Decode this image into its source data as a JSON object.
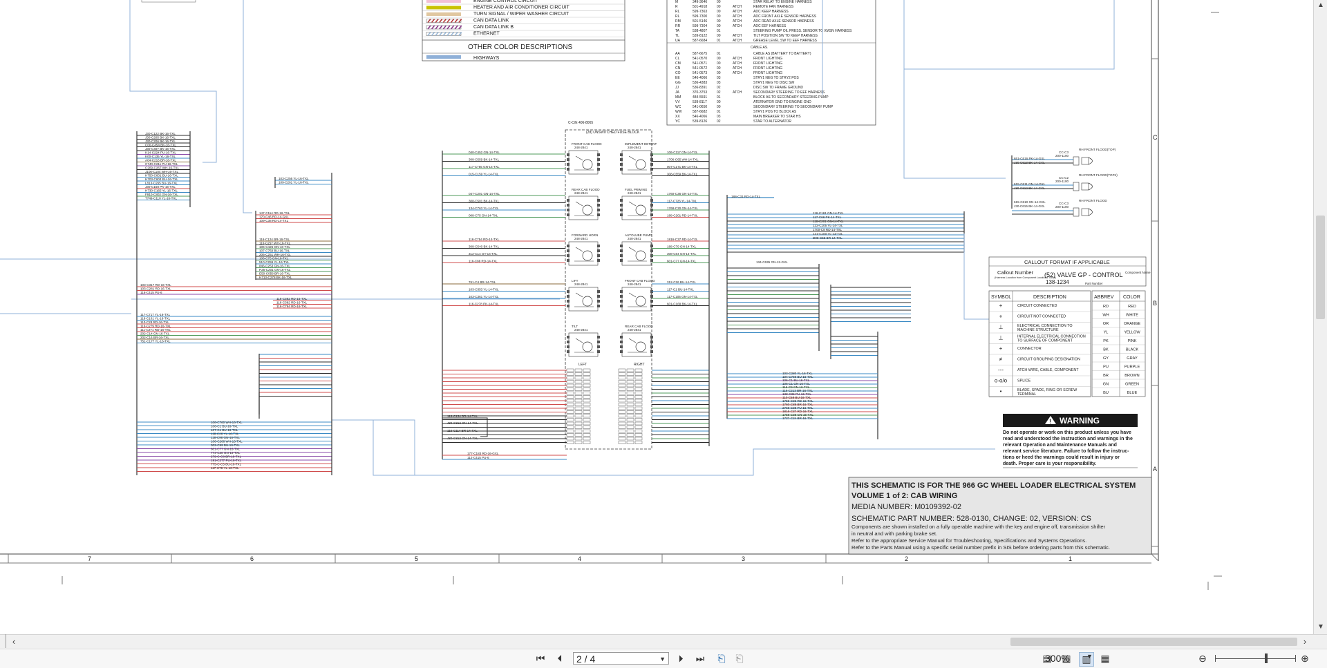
{
  "legend": {
    "rows": [
      {
        "label": "ENGINE CONTROL CIRCUIT",
        "color": "#f2c0d4",
        "style": "solid"
      },
      {
        "label": "HEATER AND AIR CONDITIONER CIRCUIT",
        "color": "#c9c200",
        "style": "solid"
      },
      {
        "label": "TURN SIGNAL / WIPER WASHER CIRCUIT",
        "color": "#e0c7a0",
        "style": "solid"
      },
      {
        "label": "CAN DATA LINK",
        "color": "#b23a3a",
        "style": "hatch"
      },
      {
        "label": "CAN DATA LINK B",
        "color": "#8a3a8a",
        "style": "hatch"
      },
      {
        "label": "ETHERNET",
        "color": "#9ab8d6",
        "style": "hatch"
      }
    ],
    "other_heading": "OTHER COLOR DESCRIPTIONS",
    "other_rows": [
      {
        "label": "HIGHWAYS",
        "color": "#8fb0d8"
      }
    ]
  },
  "parts_table": {
    "rows_top": [
      {
        "code": "M",
        "pn": "349-3646",
        "grp": "00",
        "att": "",
        "desc": "STAR RELAY TO ENGINE HARNESS"
      },
      {
        "code": "R",
        "pn": "501-4918",
        "grp": "00",
        "att": "ATCH",
        "desc": "REMOTE FAN HARNESS"
      },
      {
        "code": "RL",
        "pn": "599-7363",
        "grp": "00",
        "att": "ATCH",
        "desc": "ADC KEEP HARNESS"
      },
      {
        "code": "RL",
        "pn": "599-7300",
        "grp": "00",
        "att": "ATCH",
        "desc": "ADC FRONT AXLE SENSOR HARNESS"
      },
      {
        "code": "RM",
        "pn": "501-5146",
        "grp": "00",
        "att": "ATCH",
        "desc": "ADC REAR AXLE SENSOR HARNESS"
      },
      {
        "code": "RR",
        "pn": "599-7304",
        "grp": "00",
        "att": "ATCH",
        "desc": "ADC EEF HARNESS"
      },
      {
        "code": "TA",
        "pn": "538-4807",
        "grp": "01",
        "att": "",
        "desc": "STEERING PUMP OIL PRESS. SENSOR TO XMSN HARNESS"
      },
      {
        "code": "TL",
        "pn": "539-8122",
        "grp": "00",
        "att": "ATCH",
        "desc": "TILT POSITION SW TO KEEP HARNESS"
      },
      {
        "code": "UA",
        "pn": "587-6684",
        "grp": "01",
        "att": "ATCH",
        "desc": "GREASE LEVEL SW TO EEF HARNESS"
      }
    ],
    "cable_heading": "CABLE AS.",
    "rows_cable": [
      {
        "code": "AA",
        "pn": "587-6675",
        "grp": "01",
        "att": "",
        "desc": "CABLE AS (BATTERY TO BATTERY)"
      },
      {
        "code": "CL",
        "pn": "541-0570",
        "grp": "00",
        "att": "ATCH",
        "desc": "FRONT LIGHTING"
      },
      {
        "code": "CM",
        "pn": "541-0571",
        "grp": "00",
        "att": "ATCH",
        "desc": "FRONT LIGHTING"
      },
      {
        "code": "CN",
        "pn": "541-0572",
        "grp": "00",
        "att": "ATCH",
        "desc": "FRONT LIGHTING"
      },
      {
        "code": "CO",
        "pn": "541-0573",
        "grp": "00",
        "att": "ATCH",
        "desc": "FRONT LIGHTING"
      },
      {
        "code": "EE",
        "pn": "546-4066",
        "grp": "03",
        "att": "",
        "desc": "STRY1 NEG TO STRY2 POS"
      },
      {
        "code": "GG",
        "pn": "536-4383",
        "grp": "03",
        "att": "",
        "desc": "STRY1 NEG TO DISC SW"
      },
      {
        "code": "JJ",
        "pn": "536-8391",
        "grp": "02",
        "att": "",
        "desc": "DISC SW TO FRAME GROUND"
      },
      {
        "code": "JA",
        "pn": "370-3753",
        "grp": "02",
        "att": "ATCH",
        "desc": "SECONDARY STEERING TO EEF HARNESS"
      },
      {
        "code": "MM",
        "pn": "484-5591",
        "grp": "01",
        "att": "",
        "desc": "BLOCK AS TO SECONDARY STEERING PUMP"
      },
      {
        "code": "VV",
        "pn": "539-8117",
        "grp": "00",
        "att": "",
        "desc": "ATERNATOR GND TO ENGINE GND"
      },
      {
        "code": "WC",
        "pn": "541-0650",
        "grp": "00",
        "att": "",
        "desc": "SECONDARY STEERING TO SECONDARY PUMP"
      },
      {
        "code": "WW",
        "pn": "587-6682",
        "grp": "01",
        "att": "",
        "desc": "STRY1 POS TO BLOCK AS"
      },
      {
        "code": "XX",
        "pn": "546-4066",
        "grp": "03",
        "att": "",
        "desc": "MAIN BREAKER TO STAR HS"
      },
      {
        "code": "YC",
        "pn": "539-8126",
        "grp": "02",
        "att": "",
        "desc": "STAR TO ALTERNATOR"
      }
    ]
  },
  "fuse_block": {
    "header": "C-C/E 406-8065",
    "title": "(28) UNSWITCHED FUSE BLOCK",
    "relays_left": [
      {
        "name": "FRONT CAB FLOOD",
        "pn": "248-2841"
      },
      {
        "name": "REAR CAB FLOOD",
        "pn": "248-2841"
      },
      {
        "name": "FORWARD HORN",
        "pn": "248-2841"
      },
      {
        "name": "LIFT",
        "pn": "248-2841"
      },
      {
        "name": "TILT",
        "pn": "248-2841"
      }
    ],
    "relays_right": [
      {
        "name": "IMPLEMENT DETENT",
        "pn": "248-2841"
      },
      {
        "name": "FUEL PRIMING",
        "pn": "248-2841"
      },
      {
        "name": "AUTOLUBE PUMP",
        "pn": "248-2841"
      },
      {
        "name": "FRONT CAB FLOOD",
        "pn": "248-2841"
      },
      {
        "name": "REAR CAB FLOOD",
        "pn": "248-2841"
      }
    ],
    "left_label": "LEFT",
    "right_label": "RIGHT"
  },
  "lamps": [
    {
      "id": "CC-C3",
      "pn": "200-1100",
      "name": "RH FRONT FLOOD(TOP)"
    },
    {
      "id": "CC-C2",
      "pn": "200-1100",
      "name": "RH FRONT FLOOD(TOP4)"
    },
    {
      "id": "CC-C3",
      "pn": "200-1100",
      "name": "RH FRONT FLOOD"
    }
  ],
  "callout": {
    "title": "CALLOUT FORMAT IF APPLICABLE",
    "label": "Callout Number",
    "note": "(Harness Location from Component Locations Table)",
    "example": "(52) VALVE GP - CONTROL",
    "example2": "138-1234",
    "component": "Component Name",
    "part": "Part Number"
  },
  "symbols": {
    "h_symbol": "SYMBOL",
    "h_desc": "DESCRIPTION",
    "rows": [
      {
        "sym": "+",
        "desc": "CIRCUIT CONNECTED"
      },
      {
        "sym": "+",
        "desc": "CIRCUIT NOT CONNECTED"
      },
      {
        "sym": "⊥",
        "desc": "ELECTRICAL CONNECTION TO MACHINE STRUCTURE"
      },
      {
        "sym": "⊥",
        "desc": "INTERNAL ELECTRICAL CONNECTION TO SURFACE OF COMPONENT"
      },
      {
        "sym": "+",
        "desc": "CONNECTOR"
      },
      {
        "sym": "≠",
        "desc": "CIRCUIT GROUPING DESIGNATION"
      },
      {
        "sym": "---",
        "desc": "ATCH WIRE, CABLE, COMPONENT"
      },
      {
        "sym": "o-o/o",
        "desc": "SPLICE"
      },
      {
        "sym": "•",
        "desc": "BLADE, SPADE, RING OR SCREW TERMINAL"
      }
    ]
  },
  "abbrev": {
    "h_abbrev": "ABBREV",
    "h_color": "COLOR",
    "rows": [
      {
        "a": "RD",
        "c": "RED"
      },
      {
        "a": "WH",
        "c": "WHITE"
      },
      {
        "a": "OR",
        "c": "ORANGE"
      },
      {
        "a": "YL",
        "c": "YELLOW"
      },
      {
        "a": "PK",
        "c": "PINK"
      },
      {
        "a": "BK",
        "c": "BLACK"
      },
      {
        "a": "GY",
        "c": "GRAY"
      },
      {
        "a": "PU",
        "c": "PURPLE"
      },
      {
        "a": "BR",
        "c": "BROWN"
      },
      {
        "a": "GN",
        "c": "GREEN"
      },
      {
        "a": "BU",
        "c": "BLUE"
      }
    ]
  },
  "warning": {
    "title": "WARNING",
    "line1": "Do not operate or work on this product unless you have",
    "line2": "read and understood the instruction and warnings in the",
    "line3": "relevant Operation and Maintenance Manuals and",
    "line4": "relevant service literature. Failure to follow the instruc-",
    "line5": "tions or heed the warnings could result in injury or",
    "line6": "death. Proper care is your responsibility."
  },
  "title_block": {
    "line1": "THIS SCHEMATIC IS FOR THE 966 GC WHEEL LOADER ELECTRICAL SYSTEM",
    "line2": "VOLUME 1 of 2: CAB WIRING",
    "line3": "MEDIA NUMBER: M0109392-02",
    "line4": "SCHEMATIC PART NUMBER: 528-0130, CHANGE: 02, VERSION: CS",
    "line5": "Components are shown installed on a fully operable machine with the key and engine off, transmission shifter",
    "line6": "in neutral and with parking brake set.",
    "line7": "Refer to the appropriate Service Manual for Troubleshooting, Specifications and Systems Operations.",
    "line8": "Refer to the Parts Manual using a specific serial number prefix in SIS before ordering parts from this schematic."
  },
  "grid": {
    "columns": [
      "7",
      "6",
      "5",
      "4",
      "3",
      "2",
      "1"
    ],
    "rows": [
      "C",
      "B",
      "A"
    ]
  },
  "viewer": {
    "page_value": "2 / 4",
    "zoom": "300%",
    "icons": [
      "first-page-icon",
      "prev-page-icon",
      "next-page-icon",
      "last-page-icon",
      "copy-view-icon",
      "copy-view-2-icon",
      "single-page-icon",
      "continuous-icon",
      "two-page-icon",
      "two-page-continuous-icon",
      "zoom-out-icon",
      "zoom-in-icon"
    ]
  },
  "wire_labels": {
    "a": [
      "J30-C122 BK-16-TXL",
      "J30-C205 BK-16-TXL",
      "J30-C206 BK-16-TXL",
      "C00-C454 BK-16-TXL",
      "J30-C407 BK-16-TXL",
      "K14-C224 PU-16-TXL",
      "K00-C135 YL-16-TXL",
      "A04-C216 BR-16-TXL",
      "C740-C211 PU-16-TXL",
      "C209-C267 WH-16-TXL",
      "J100-C104 WH-16-TXL",
      "H750-C601 BU-16-TXL",
      "H703-C604 BU-16-TXL",
      "L813-C265 BU-16-TXL",
      "J30-C158 PK-16-TXL",
      "H730-C165 YL-16-TXL",
      "F910-C802 GN-16-TXL",
      "T749-C110 YL-16-TXL"
    ],
    "b": [
      "103-C256 YL-16-TXL",
      "109-C261 YL-16-TXL"
    ],
    "c": [
      "147-C114 RD-16-TXL",
      "170-C46 RD-14-GXL",
      "109-C38 RD-14-TXL"
    ],
    "d": [
      "116-C124 BR-16-TXL",
      "116-C257 WH-16-TXL",
      "106-C426 GN-16-TXL",
      "107-C750 BU-16-TXL",
      "206-C251 WH-16-TXL",
      "106-C75 GN-16-TXL",
      "510-C259 YL-16-TXL",
      "846-C253 GN-16-TXL",
      "P25-C201 GN-16-TXL",
      "E50-C058 BR-16-TXL",
      "H713-C278 BK-16-TXL"
    ],
    "e": [
      "103-C317 RD-16-TXL",
      "103-C281 RD-16-TXL",
      "116-C415 PU-6"
    ],
    "f": [
      "116-C382 RD-16-TXL",
      "116-C382 RD-16-TXL",
      "116-C794 RD-16-TXL"
    ],
    "g": [
      "117-C717 YL-16-TXL",
      "118-C101 YL-16-TXL",
      "110-C28 RD-16-TXL",
      "116-C279 RD-16-TXL",
      "111-C271 RD-16-TXL",
      "202-C14 GN-16-TXL",
      "202-C14 BR-16-TXL",
      "751-C177 YL-16-TXL"
    ]
  }
}
